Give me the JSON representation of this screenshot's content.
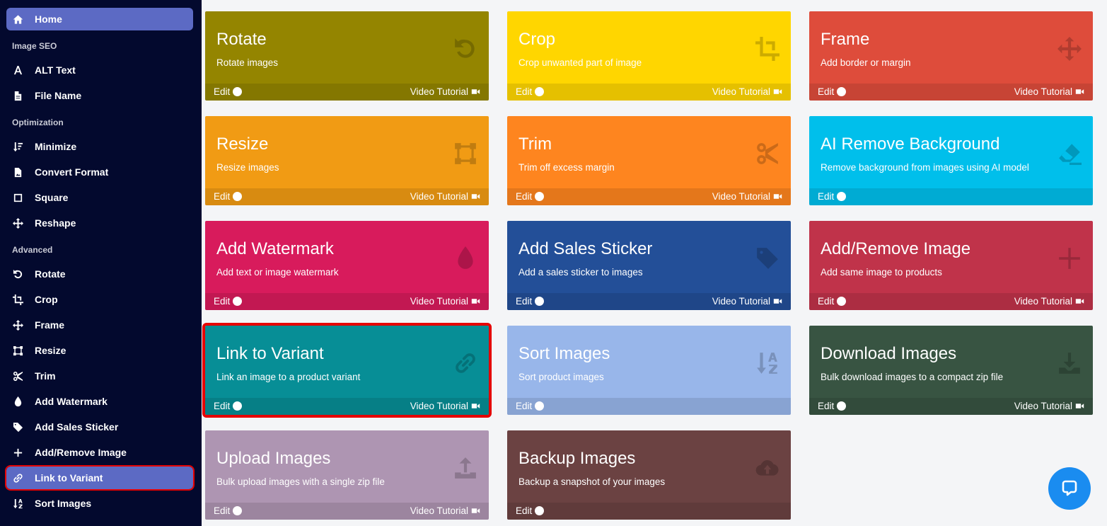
{
  "sidebar": {
    "home": "Home",
    "sections": {
      "image_seo": "Image SEO",
      "optimization": "Optimization",
      "advanced": "Advanced"
    },
    "items": {
      "alt_text": "ALT Text",
      "file_name": "File Name",
      "minimize": "Minimize",
      "convert_format": "Convert Format",
      "square": "Square",
      "reshape": "Reshape",
      "rotate": "Rotate",
      "crop": "Crop",
      "frame": "Frame",
      "resize": "Resize",
      "trim": "Trim",
      "add_watermark": "Add Watermark",
      "add_sales_sticker": "Add Sales Sticker",
      "add_remove_image": "Add/Remove Image",
      "link_to_variant": "Link to Variant",
      "sort_images": "Sort Images"
    }
  },
  "cards": {
    "edit_label": "Edit",
    "video_label": "Video Tutorial",
    "rotate": {
      "title": "Rotate",
      "desc": "Rotate images",
      "color": "#948500",
      "icon": "undo-icon"
    },
    "crop": {
      "title": "Crop",
      "desc": "Crop unwanted part of image",
      "color": "#ffd600",
      "icon": "crop-icon"
    },
    "frame": {
      "title": "Frame",
      "desc": "Add border or margin",
      "color": "#de4c3b",
      "icon": "arrows-icon"
    },
    "resize": {
      "title": "Resize",
      "desc": "Resize images",
      "color": "#f19b14",
      "icon": "resize-icon"
    },
    "trim": {
      "title": "Trim",
      "desc": "Trim off excess margin",
      "color": "#fe851f",
      "icon": "scissors-icon"
    },
    "ai_remove_bg": {
      "title": "AI Remove Background",
      "desc": "Remove background from images using AI model",
      "color": "#00bfeb",
      "icon": "eraser-icon"
    },
    "add_watermark": {
      "title": "Add Watermark",
      "desc": "Add text or image watermark",
      "color": "#d81b5c",
      "icon": "droplet-icon"
    },
    "add_sales_sticker": {
      "title": "Add Sales Sticker",
      "desc": "Add a sales sticker to images",
      "color": "#234f98",
      "icon": "tag-icon"
    },
    "add_remove_image": {
      "title": "Add/Remove Image",
      "desc": "Add same image to products",
      "color": "#c0334a",
      "icon": "plus-icon"
    },
    "link_to_variant": {
      "title": "Link to Variant",
      "desc": "Link an image to a product variant",
      "color": "#078e96",
      "icon": "link-icon"
    },
    "sort_images": {
      "title": "Sort Images",
      "desc": "Sort product images",
      "color": "#98b6ea",
      "icon": "sort-icon"
    },
    "download_images": {
      "title": "Download Images",
      "desc": "Bulk download images to a compact zip file",
      "color": "#385442",
      "icon": "download-icon"
    },
    "upload_images": {
      "title": "Upload Images",
      "desc": "Bulk upload images with a single zip file",
      "color": "#ae95b2",
      "icon": "upload-icon"
    },
    "backup_images": {
      "title": "Backup Images",
      "desc": "Backup a snapshot of your images",
      "color": "#6b4242",
      "icon": "cloud-upload-icon"
    }
  }
}
